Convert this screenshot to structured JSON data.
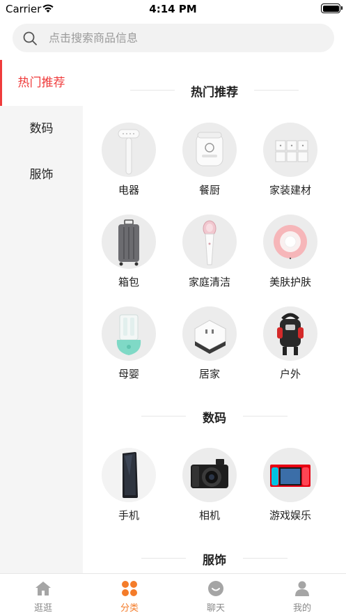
{
  "status_bar": {
    "carrier": "Carrier",
    "time": "4:14 PM",
    "battery_level": 1.0
  },
  "search": {
    "placeholder": "点击搜索商品信息",
    "icon": "search-icon"
  },
  "sidebar": {
    "items": [
      {
        "label": "热门推荐",
        "active": true
      },
      {
        "label": "数码",
        "active": false
      },
      {
        "label": "服饰",
        "active": false
      }
    ],
    "active_color": "#ef3b3b"
  },
  "sections": [
    {
      "title": "热门推荐",
      "items": [
        {
          "label": "电器",
          "icon": "steamer-icon"
        },
        {
          "label": "餐厨",
          "icon": "rice-cooker-icon"
        },
        {
          "label": "家装建材",
          "icon": "switch-panel-icon"
        },
        {
          "label": "箱包",
          "icon": "suitcase-icon"
        },
        {
          "label": "家庭清洁",
          "icon": "facial-device-icon"
        },
        {
          "label": "美肤护肤",
          "icon": "beauty-device-icon"
        },
        {
          "label": "母婴",
          "icon": "bottle-sterilizer-icon"
        },
        {
          "label": "居家",
          "icon": "smart-plug-icon"
        },
        {
          "label": "户外",
          "icon": "backpack-icon"
        }
      ]
    },
    {
      "title": "数码",
      "items": [
        {
          "label": "手机",
          "icon": "phone-icon"
        },
        {
          "label": "相机",
          "icon": "camera-icon"
        },
        {
          "label": "游戏娱乐",
          "icon": "game-console-icon"
        }
      ]
    },
    {
      "title": "服饰",
      "items": []
    }
  ],
  "tabbar": {
    "active_color": "#f47c2a",
    "tabs": [
      {
        "label": "逛逛",
        "icon": "home-icon",
        "active": false
      },
      {
        "label": "分类",
        "icon": "category-icon",
        "active": true
      },
      {
        "label": "聊天",
        "icon": "chat-icon",
        "active": false
      },
      {
        "label": "我的",
        "icon": "profile-icon",
        "active": false
      }
    ]
  }
}
